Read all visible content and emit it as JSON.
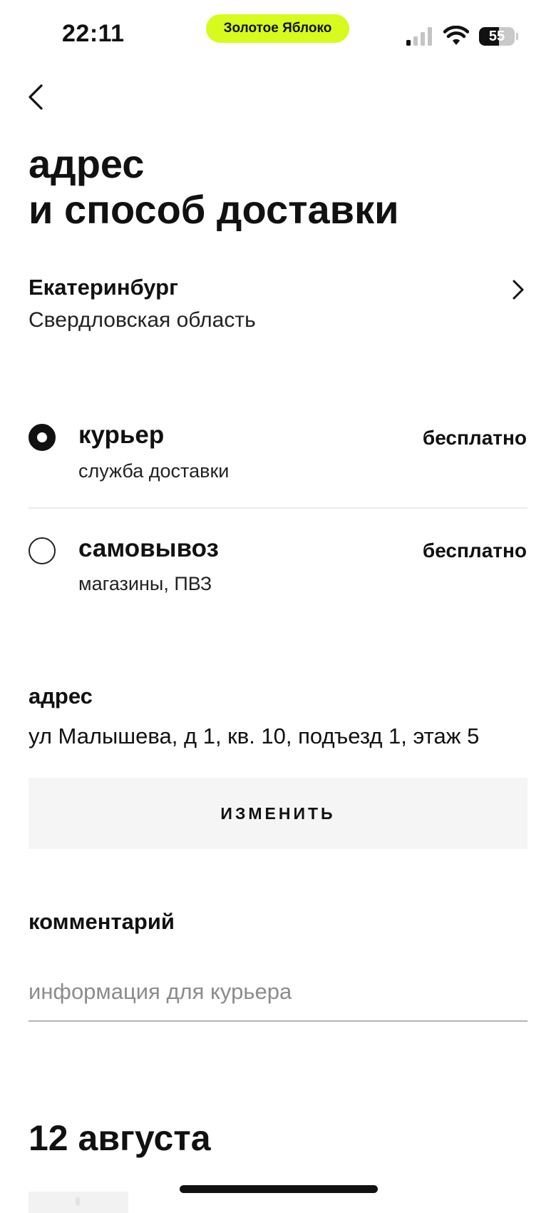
{
  "status_bar": {
    "time": "22:11",
    "app_name": "Золотое Яблоко",
    "battery_level": "55",
    "battery_fraction": 0.55,
    "icons": [
      "signal-icon",
      "wifi-icon",
      "battery-icon"
    ]
  },
  "colors": {
    "accent": "#d7fb1c",
    "text": "#111111",
    "button_bg": "#f5f5f5",
    "divider": "#ececec"
  },
  "header": {
    "back_icon": "back-chevron-icon",
    "title_line1": "адрес",
    "title_line2": "и способ доставки"
  },
  "location": {
    "city": "Екатеринбург",
    "region": "Свердловская область",
    "icon": "chevron-right-icon"
  },
  "delivery_options": [
    {
      "title": "курьер",
      "subtitle": "служба доставки",
      "price": "бесплатно",
      "selected": true
    },
    {
      "title": "самовывоз",
      "subtitle": "магазины, ПВЗ",
      "price": "бесплатно",
      "selected": false
    }
  ],
  "address": {
    "label": "адрес",
    "value": "ул Малышева, д 1, кв. 10, подъезд 1, этаж 5",
    "change_button": "ИЗМЕНИТЬ"
  },
  "comment": {
    "label": "комментарий",
    "value": "",
    "placeholder": "информация для курьера"
  },
  "schedule": {
    "date": "12 августа"
  }
}
